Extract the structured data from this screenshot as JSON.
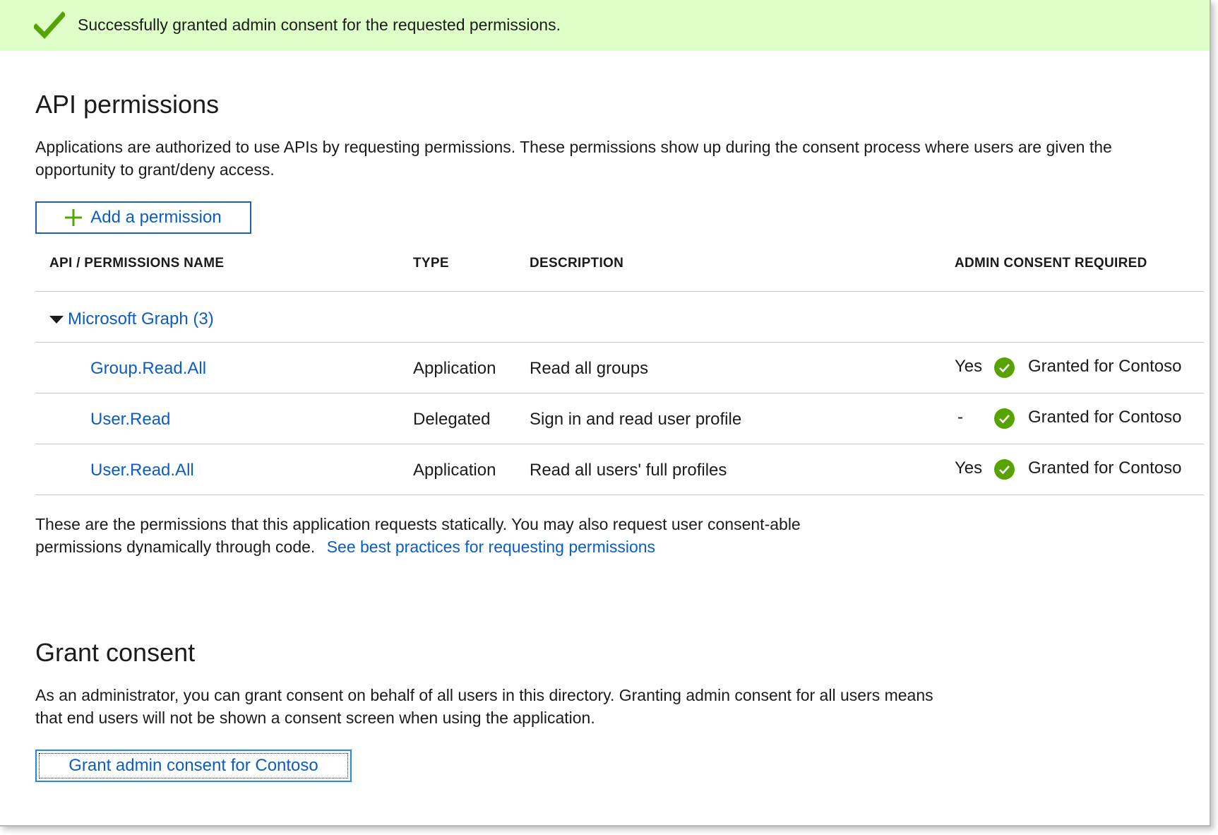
{
  "banner": {
    "message": "Successfully granted admin consent for the requested permissions.",
    "icon": "checkmark-icon",
    "color": "#dfffc8"
  },
  "api_permissions": {
    "title": "API permissions",
    "description_line1": "Applications are authorized to use APIs by requesting permissions. These permissions show up during the consent process where users are given the",
    "description_line2": "opportunity to grant/deny access.",
    "add_button_label": "Add a permission"
  },
  "table": {
    "headers": {
      "name": "API / PERMISSIONS NAME",
      "type": "TYPE",
      "description": "DESCRIPTION",
      "admin_consent": "ADMIN CONSENT REQUIRED"
    },
    "group": "Microsoft Graph (3)",
    "rows": [
      {
        "name": "Group.Read.All",
        "type": "Application",
        "description": "Read all groups",
        "admin_consent": "Yes",
        "status": "Granted for Contoso"
      },
      {
        "name": "User.Read",
        "type": "Delegated",
        "description": "Sign in and read user profile",
        "admin_consent": "-",
        "status": "Granted for Contoso"
      },
      {
        "name": "User.Read.All",
        "type": "Application",
        "description": "Read all users' full profiles",
        "admin_consent": "Yes",
        "status": "Granted for Contoso"
      }
    ]
  },
  "footer_note": {
    "line1": "These are the permissions that this application requests statically. You may also request user consent-able",
    "line2": "permissions dynamically through code.",
    "link": "See best practices for requesting permissions"
  },
  "grant_consent": {
    "title": "Grant consent",
    "description_line1": "As an administrator, you can grant consent on behalf of all users in this directory. Granting admin consent for all users means",
    "description_line2": "that end users will not be shown a consent screen when using the application.",
    "button_label": "Grant admin consent for Contoso"
  },
  "colors": {
    "accent_blue": "#0b5cc5",
    "success_green": "#57a300"
  }
}
